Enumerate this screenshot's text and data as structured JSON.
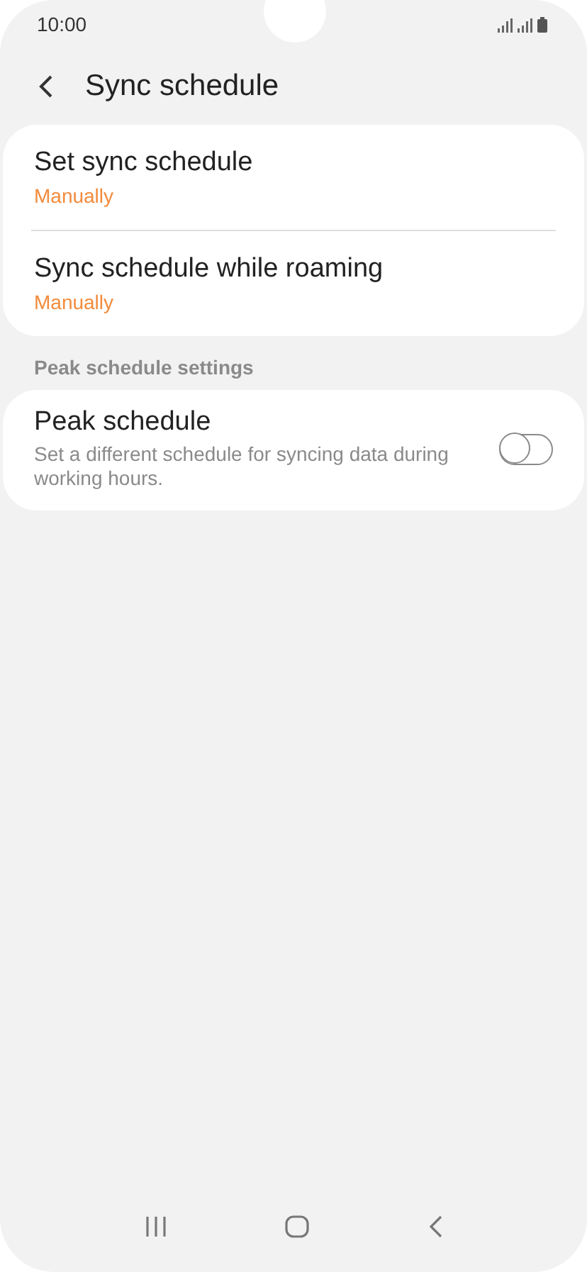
{
  "status_bar": {
    "time": "10:00"
  },
  "header": {
    "title": "Sync schedule"
  },
  "sync_card": {
    "items": [
      {
        "title": "Set sync schedule",
        "value": "Manually"
      },
      {
        "title": "Sync schedule while roaming",
        "value": "Manually"
      }
    ]
  },
  "peak_section": {
    "heading": "Peak schedule settings",
    "item": {
      "title": "Peak schedule",
      "description": "Set a different schedule for syncing data during working hours.",
      "on": false
    }
  }
}
